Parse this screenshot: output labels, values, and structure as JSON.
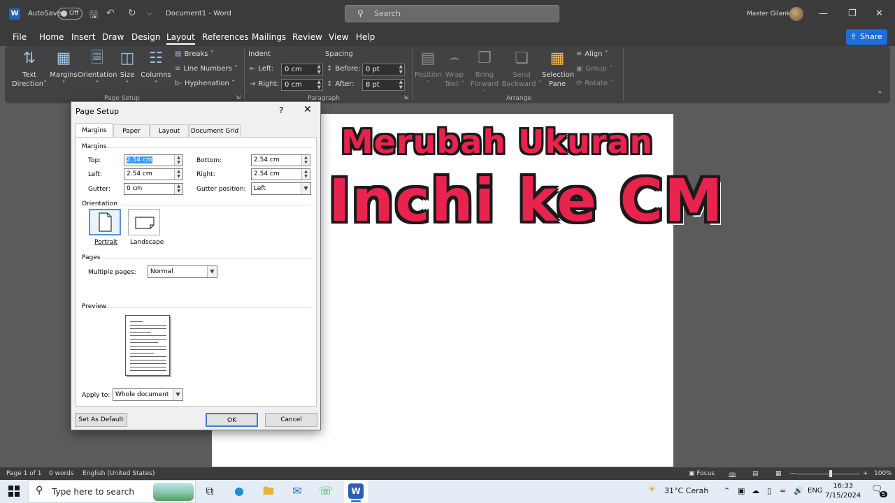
{
  "titlebar": {
    "app_icon_letter": "W",
    "autosave_label": "AutoSave",
    "autosave_state": "Off",
    "document_title": "Document1  -  Word",
    "search_placeholder": "Search",
    "user_name": "Master Gilank"
  },
  "menu": {
    "tabs": [
      "File",
      "Home",
      "Insert",
      "Draw",
      "Design",
      "Layout",
      "References",
      "Mailings",
      "Review",
      "View",
      "Help"
    ],
    "active_tab": "Layout",
    "share_label": "Share"
  },
  "ribbon": {
    "page_setup": {
      "text_direction": [
        "Text",
        "Direction"
      ],
      "margins": "Margins",
      "orientation": "Orientation",
      "size": "Size",
      "columns": "Columns",
      "breaks": "Breaks",
      "line_numbers": "Line Numbers",
      "hyphenation": "Hyphenation",
      "group_label": "Page Setup"
    },
    "paragraph": {
      "indent_label": "Indent",
      "spacing_label": "Spacing",
      "left_label": "Left:",
      "left_value": "0 cm",
      "right_label": "Right:",
      "right_value": "0 cm",
      "before_label": "Before:",
      "before_value": "0 pt",
      "after_label": "After:",
      "after_value": "8 pt",
      "group_label": "Paragraph"
    },
    "arrange": {
      "position": "Position",
      "wrap_text": [
        "Wrap",
        "Text"
      ],
      "bring_forward": [
        "Bring",
        "Forward"
      ],
      "send_backward": [
        "Send",
        "Backward"
      ],
      "selection_pane": [
        "Selection",
        "Pane"
      ],
      "align": "Align",
      "group": "Group",
      "rotate": "Rotate",
      "group_label": "Arrange"
    }
  },
  "overlay": {
    "line1": "Merubah Ukuran",
    "line2": "Inchi ke CM"
  },
  "dialog": {
    "title": "Page Setup",
    "help": "?",
    "tabs": [
      "Margins",
      "Paper",
      "Layout",
      "Document Grid"
    ],
    "active_tab": "Margins",
    "margins_section": "Margins",
    "top_label": "Top:",
    "top_value": "2.54 cm",
    "bottom_label": "Bottom:",
    "bottom_value": "2.54 cm",
    "left_label": "Left:",
    "left_value": "2.54 cm",
    "right_label": "Right:",
    "right_value": "2.54 cm",
    "gutter_label": "Gutter:",
    "gutter_value": "0 cm",
    "gutter_position_label": "Gutter position:",
    "gutter_position_value": "Left",
    "orientation_section": "Orientation",
    "portrait_label": "Portrait",
    "landscape_label": "Landscape",
    "selected_orientation": "Portrait",
    "pages_section": "Pages",
    "multiple_pages_label": "Multiple pages:",
    "multiple_pages_value": "Normal",
    "preview_section": "Preview",
    "apply_to_label": "Apply to:",
    "apply_to_value": "Whole document",
    "set_default_label": "Set As Default",
    "ok_label": "OK",
    "cancel_label": "Cancel"
  },
  "statusbar": {
    "page": "Page 1 of 1",
    "words": "0 words",
    "language": "English (United States)",
    "focus": "Focus",
    "zoom": "100%"
  },
  "taskbar": {
    "search_placeholder": "Type here to search",
    "weather": "31°C  Cerah",
    "language": "ENG",
    "time": "16:33",
    "date": "7/15/2024",
    "notification_count": "5"
  },
  "colors": {
    "overlay_text": "#e8234e",
    "accent": "#1d6fd6",
    "titlebar": "#3b3b3b"
  }
}
